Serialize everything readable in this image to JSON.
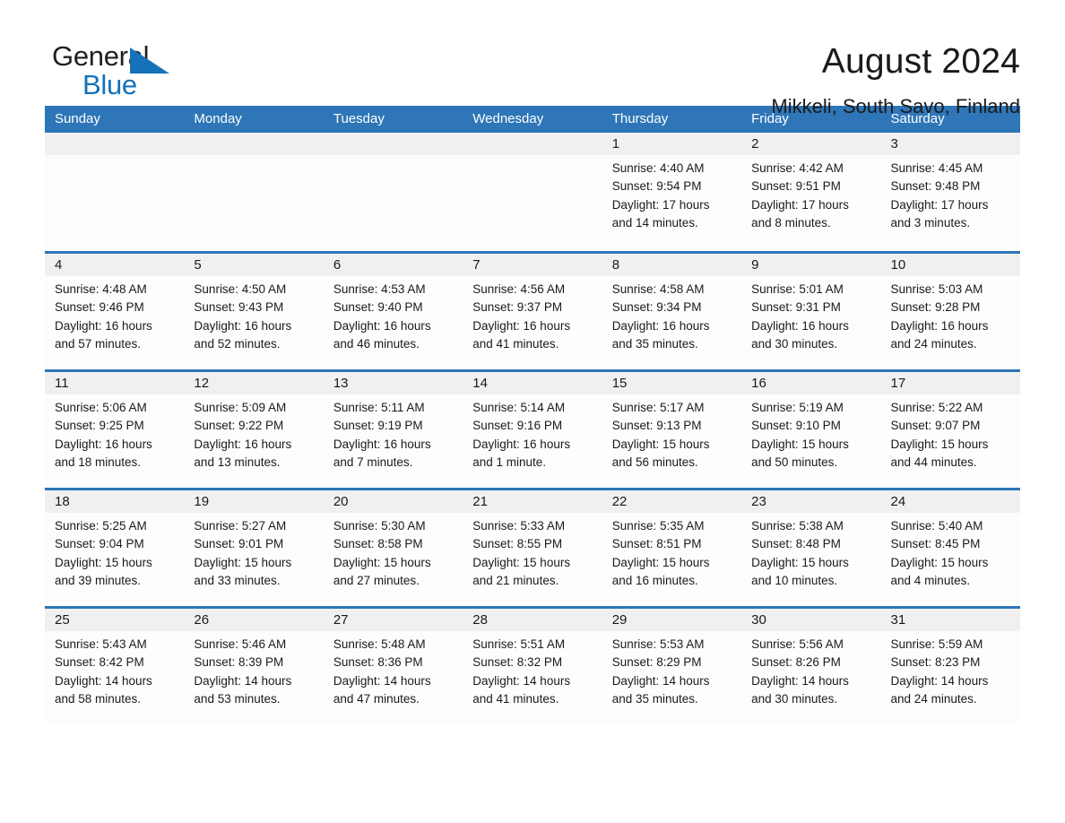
{
  "brand": {
    "name_top": "General",
    "name_bottom": "Blue",
    "accent_color": "#1672b8"
  },
  "header": {
    "title": "August 2024",
    "subtitle": "Mikkeli, South Savo, Finland"
  },
  "theme": {
    "header_blue": "#2e76b8",
    "date_band_gray": "#f0f0f0",
    "cell_bg": "#fdfdfd",
    "text": "#1a1a1a"
  },
  "weekdays": [
    "Sunday",
    "Monday",
    "Tuesday",
    "Wednesday",
    "Thursday",
    "Friday",
    "Saturday"
  ],
  "weeks": [
    [
      {
        "day": "",
        "empty": true
      },
      {
        "day": "",
        "empty": true
      },
      {
        "day": "",
        "empty": true
      },
      {
        "day": "",
        "empty": true
      },
      {
        "day": "1",
        "sunrise": "Sunrise: 4:40 AM",
        "sunset": "Sunset: 9:54 PM",
        "daylight1": "Daylight: 17 hours",
        "daylight2": "and 14 minutes."
      },
      {
        "day": "2",
        "sunrise": "Sunrise: 4:42 AM",
        "sunset": "Sunset: 9:51 PM",
        "daylight1": "Daylight: 17 hours",
        "daylight2": "and 8 minutes."
      },
      {
        "day": "3",
        "sunrise": "Sunrise: 4:45 AM",
        "sunset": "Sunset: 9:48 PM",
        "daylight1": "Daylight: 17 hours",
        "daylight2": "and 3 minutes."
      }
    ],
    [
      {
        "day": "4",
        "sunrise": "Sunrise: 4:48 AM",
        "sunset": "Sunset: 9:46 PM",
        "daylight1": "Daylight: 16 hours",
        "daylight2": "and 57 minutes."
      },
      {
        "day": "5",
        "sunrise": "Sunrise: 4:50 AM",
        "sunset": "Sunset: 9:43 PM",
        "daylight1": "Daylight: 16 hours",
        "daylight2": "and 52 minutes."
      },
      {
        "day": "6",
        "sunrise": "Sunrise: 4:53 AM",
        "sunset": "Sunset: 9:40 PM",
        "daylight1": "Daylight: 16 hours",
        "daylight2": "and 46 minutes."
      },
      {
        "day": "7",
        "sunrise": "Sunrise: 4:56 AM",
        "sunset": "Sunset: 9:37 PM",
        "daylight1": "Daylight: 16 hours",
        "daylight2": "and 41 minutes."
      },
      {
        "day": "8",
        "sunrise": "Sunrise: 4:58 AM",
        "sunset": "Sunset: 9:34 PM",
        "daylight1": "Daylight: 16 hours",
        "daylight2": "and 35 minutes."
      },
      {
        "day": "9",
        "sunrise": "Sunrise: 5:01 AM",
        "sunset": "Sunset: 9:31 PM",
        "daylight1": "Daylight: 16 hours",
        "daylight2": "and 30 minutes."
      },
      {
        "day": "10",
        "sunrise": "Sunrise: 5:03 AM",
        "sunset": "Sunset: 9:28 PM",
        "daylight1": "Daylight: 16 hours",
        "daylight2": "and 24 minutes."
      }
    ],
    [
      {
        "day": "11",
        "sunrise": "Sunrise: 5:06 AM",
        "sunset": "Sunset: 9:25 PM",
        "daylight1": "Daylight: 16 hours",
        "daylight2": "and 18 minutes."
      },
      {
        "day": "12",
        "sunrise": "Sunrise: 5:09 AM",
        "sunset": "Sunset: 9:22 PM",
        "daylight1": "Daylight: 16 hours",
        "daylight2": "and 13 minutes."
      },
      {
        "day": "13",
        "sunrise": "Sunrise: 5:11 AM",
        "sunset": "Sunset: 9:19 PM",
        "daylight1": "Daylight: 16 hours",
        "daylight2": "and 7 minutes."
      },
      {
        "day": "14",
        "sunrise": "Sunrise: 5:14 AM",
        "sunset": "Sunset: 9:16 PM",
        "daylight1": "Daylight: 16 hours",
        "daylight2": "and 1 minute."
      },
      {
        "day": "15",
        "sunrise": "Sunrise: 5:17 AM",
        "sunset": "Sunset: 9:13 PM",
        "daylight1": "Daylight: 15 hours",
        "daylight2": "and 56 minutes."
      },
      {
        "day": "16",
        "sunrise": "Sunrise: 5:19 AM",
        "sunset": "Sunset: 9:10 PM",
        "daylight1": "Daylight: 15 hours",
        "daylight2": "and 50 minutes."
      },
      {
        "day": "17",
        "sunrise": "Sunrise: 5:22 AM",
        "sunset": "Sunset: 9:07 PM",
        "daylight1": "Daylight: 15 hours",
        "daylight2": "and 44 minutes."
      }
    ],
    [
      {
        "day": "18",
        "sunrise": "Sunrise: 5:25 AM",
        "sunset": "Sunset: 9:04 PM",
        "daylight1": "Daylight: 15 hours",
        "daylight2": "and 39 minutes."
      },
      {
        "day": "19",
        "sunrise": "Sunrise: 5:27 AM",
        "sunset": "Sunset: 9:01 PM",
        "daylight1": "Daylight: 15 hours",
        "daylight2": "and 33 minutes."
      },
      {
        "day": "20",
        "sunrise": "Sunrise: 5:30 AM",
        "sunset": "Sunset: 8:58 PM",
        "daylight1": "Daylight: 15 hours",
        "daylight2": "and 27 minutes."
      },
      {
        "day": "21",
        "sunrise": "Sunrise: 5:33 AM",
        "sunset": "Sunset: 8:55 PM",
        "daylight1": "Daylight: 15 hours",
        "daylight2": "and 21 minutes."
      },
      {
        "day": "22",
        "sunrise": "Sunrise: 5:35 AM",
        "sunset": "Sunset: 8:51 PM",
        "daylight1": "Daylight: 15 hours",
        "daylight2": "and 16 minutes."
      },
      {
        "day": "23",
        "sunrise": "Sunrise: 5:38 AM",
        "sunset": "Sunset: 8:48 PM",
        "daylight1": "Daylight: 15 hours",
        "daylight2": "and 10 minutes."
      },
      {
        "day": "24",
        "sunrise": "Sunrise: 5:40 AM",
        "sunset": "Sunset: 8:45 PM",
        "daylight1": "Daylight: 15 hours",
        "daylight2": "and 4 minutes."
      }
    ],
    [
      {
        "day": "25",
        "sunrise": "Sunrise: 5:43 AM",
        "sunset": "Sunset: 8:42 PM",
        "daylight1": "Daylight: 14 hours",
        "daylight2": "and 58 minutes."
      },
      {
        "day": "26",
        "sunrise": "Sunrise: 5:46 AM",
        "sunset": "Sunset: 8:39 PM",
        "daylight1": "Daylight: 14 hours",
        "daylight2": "and 53 minutes."
      },
      {
        "day": "27",
        "sunrise": "Sunrise: 5:48 AM",
        "sunset": "Sunset: 8:36 PM",
        "daylight1": "Daylight: 14 hours",
        "daylight2": "and 47 minutes."
      },
      {
        "day": "28",
        "sunrise": "Sunrise: 5:51 AM",
        "sunset": "Sunset: 8:32 PM",
        "daylight1": "Daylight: 14 hours",
        "daylight2": "and 41 minutes."
      },
      {
        "day": "29",
        "sunrise": "Sunrise: 5:53 AM",
        "sunset": "Sunset: 8:29 PM",
        "daylight1": "Daylight: 14 hours",
        "daylight2": "and 35 minutes."
      },
      {
        "day": "30",
        "sunrise": "Sunrise: 5:56 AM",
        "sunset": "Sunset: 8:26 PM",
        "daylight1": "Daylight: 14 hours",
        "daylight2": "and 30 minutes."
      },
      {
        "day": "31",
        "sunrise": "Sunrise: 5:59 AM",
        "sunset": "Sunset: 8:23 PM",
        "daylight1": "Daylight: 14 hours",
        "daylight2": "and 24 minutes."
      }
    ]
  ]
}
